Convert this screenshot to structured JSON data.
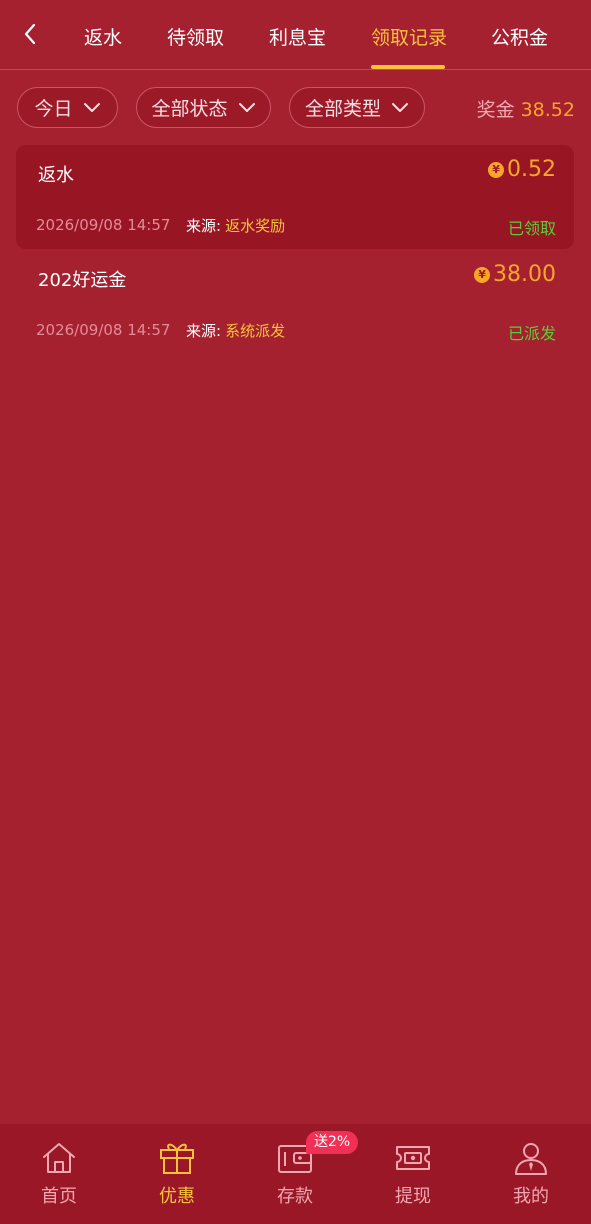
{
  "nav": {
    "back_icon": "chevron-left-icon",
    "tabs": [
      {
        "label": "返水"
      },
      {
        "label": "待领取"
      },
      {
        "label": "利息宝"
      },
      {
        "label": "领取记录"
      },
      {
        "label": "公积金"
      }
    ],
    "active_tab": "领取记录"
  },
  "filters": {
    "date": "今日",
    "status": "全部状态",
    "type": "全部类型"
  },
  "bonus": {
    "label": "奖金",
    "value": "38.52"
  },
  "records": [
    {
      "title": "返水",
      "currency": "¥",
      "amount": "0.52",
      "time": "2026/09/08 14:57",
      "source_label": "来源:",
      "source": "返水奖励",
      "status": "已领取"
    },
    {
      "title": "202好运金",
      "currency": "¥",
      "amount": "38.00",
      "time": "2026/09/08 14:57",
      "source_label": "来源:",
      "source": "系统派发",
      "status": "已派发"
    }
  ],
  "bottom_nav": [
    {
      "label": "首页",
      "icon": "home-icon"
    },
    {
      "label": "优惠",
      "icon": "gift-icon"
    },
    {
      "label": "存款",
      "icon": "wallet-icon"
    },
    {
      "label": "提现",
      "icon": "withdraw-ticket-icon"
    },
    {
      "label": "我的",
      "icon": "user-icon"
    }
  ],
  "deposit_badge": "送2%",
  "colors": {
    "background": "#a52130",
    "accent_yellow": "#f8c33a",
    "amount_orange": "#f8a62a",
    "status_green": "#5dcc3a",
    "badge_pink": "#f03056"
  }
}
